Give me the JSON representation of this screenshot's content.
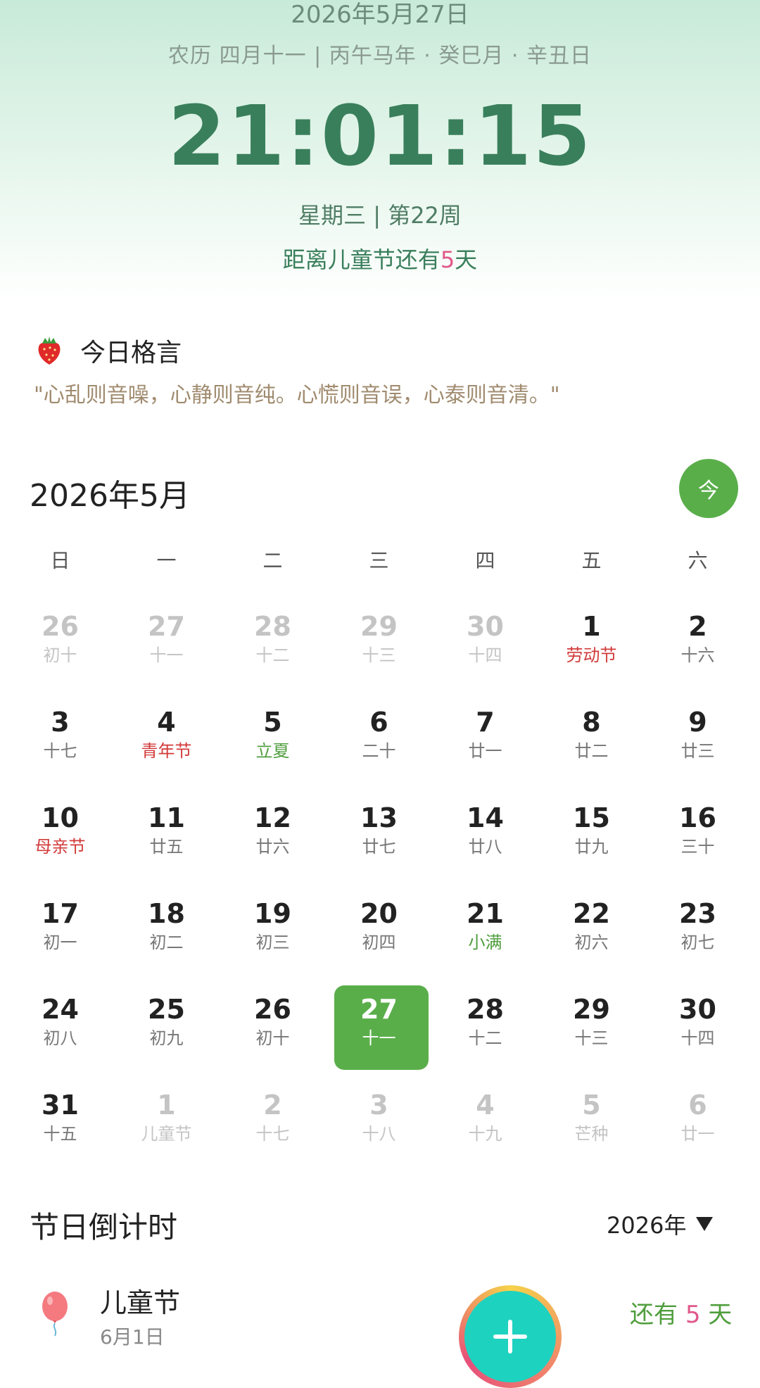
{
  "header": {
    "date": "2026年5月27日",
    "lunar": "农历 四月十一 | 丙午马年 · 癸巳月 · 辛丑日",
    "time": "21:01:15",
    "week_info": "星期三 | 第22周",
    "countdown_prefix": "距离儿童节还有",
    "countdown_days": "5",
    "countdown_suffix": "天"
  },
  "motto": {
    "icon": "strawberry-icon",
    "title": "今日格言",
    "text": "\"心乱则音噪，心静则音纯。心慌则音误，心泰则音清。\""
  },
  "calendar": {
    "month_title": "2026年5月",
    "today_label": "今",
    "weekdays": [
      "日",
      "一",
      "二",
      "三",
      "四",
      "五",
      "六"
    ],
    "weeks": [
      [
        {
          "num": "26",
          "sub": "初十",
          "type": "other"
        },
        {
          "num": "27",
          "sub": "十一",
          "type": "other"
        },
        {
          "num": "28",
          "sub": "十二",
          "type": "other"
        },
        {
          "num": "29",
          "sub": "十三",
          "type": "other"
        },
        {
          "num": "30",
          "sub": "十四",
          "type": "other"
        },
        {
          "num": "1",
          "sub": "劳动节",
          "type": "holiday"
        },
        {
          "num": "2",
          "sub": "十六",
          "type": "normal"
        }
      ],
      [
        {
          "num": "3",
          "sub": "十七",
          "type": "normal"
        },
        {
          "num": "4",
          "sub": "青年节",
          "type": "holiday"
        },
        {
          "num": "5",
          "sub": "立夏",
          "type": "term"
        },
        {
          "num": "6",
          "sub": "二十",
          "type": "normal"
        },
        {
          "num": "7",
          "sub": "廿一",
          "type": "normal"
        },
        {
          "num": "8",
          "sub": "廿二",
          "type": "normal"
        },
        {
          "num": "9",
          "sub": "廿三",
          "type": "normal"
        }
      ],
      [
        {
          "num": "10",
          "sub": "母亲节",
          "type": "holiday"
        },
        {
          "num": "11",
          "sub": "廿五",
          "type": "normal"
        },
        {
          "num": "12",
          "sub": "廿六",
          "type": "normal"
        },
        {
          "num": "13",
          "sub": "廿七",
          "type": "normal"
        },
        {
          "num": "14",
          "sub": "廿八",
          "type": "normal"
        },
        {
          "num": "15",
          "sub": "廿九",
          "type": "normal"
        },
        {
          "num": "16",
          "sub": "三十",
          "type": "normal"
        }
      ],
      [
        {
          "num": "17",
          "sub": "初一",
          "type": "normal"
        },
        {
          "num": "18",
          "sub": "初二",
          "type": "normal"
        },
        {
          "num": "19",
          "sub": "初三",
          "type": "normal"
        },
        {
          "num": "20",
          "sub": "初四",
          "type": "normal"
        },
        {
          "num": "21",
          "sub": "小满",
          "type": "term"
        },
        {
          "num": "22",
          "sub": "初六",
          "type": "normal"
        },
        {
          "num": "23",
          "sub": "初七",
          "type": "normal"
        }
      ],
      [
        {
          "num": "24",
          "sub": "初八",
          "type": "normal"
        },
        {
          "num": "25",
          "sub": "初九",
          "type": "normal"
        },
        {
          "num": "26",
          "sub": "初十",
          "type": "normal"
        },
        {
          "num": "27",
          "sub": "十一",
          "type": "today"
        },
        {
          "num": "28",
          "sub": "十二",
          "type": "normal"
        },
        {
          "num": "29",
          "sub": "十三",
          "type": "normal"
        },
        {
          "num": "30",
          "sub": "十四",
          "type": "normal"
        }
      ],
      [
        {
          "num": "31",
          "sub": "十五",
          "type": "normal"
        },
        {
          "num": "1",
          "sub": "儿童节",
          "type": "other"
        },
        {
          "num": "2",
          "sub": "十七",
          "type": "other"
        },
        {
          "num": "3",
          "sub": "十八",
          "type": "other"
        },
        {
          "num": "4",
          "sub": "十九",
          "type": "other"
        },
        {
          "num": "5",
          "sub": "芒种",
          "type": "other"
        },
        {
          "num": "6",
          "sub": "廿一",
          "type": "other"
        }
      ]
    ]
  },
  "countdown": {
    "title": "节日倒计时",
    "year_label": "2026年",
    "items": [
      {
        "name": "儿童节",
        "date": "6月1日",
        "remain_prefix": "还有",
        "remain_days": "5",
        "remain_suffix": "天",
        "icon": "balloon-icon"
      }
    ]
  },
  "fab": {
    "icon": "plus-icon"
  },
  "colors": {
    "accent_green": "#5aae4a",
    "time_green": "#3a7f5c",
    "holiday_red": "#d23a3a",
    "term_green": "#4f9e3d",
    "countdown_pink": "#e0588a",
    "fab_teal": "#1ed2c0"
  }
}
